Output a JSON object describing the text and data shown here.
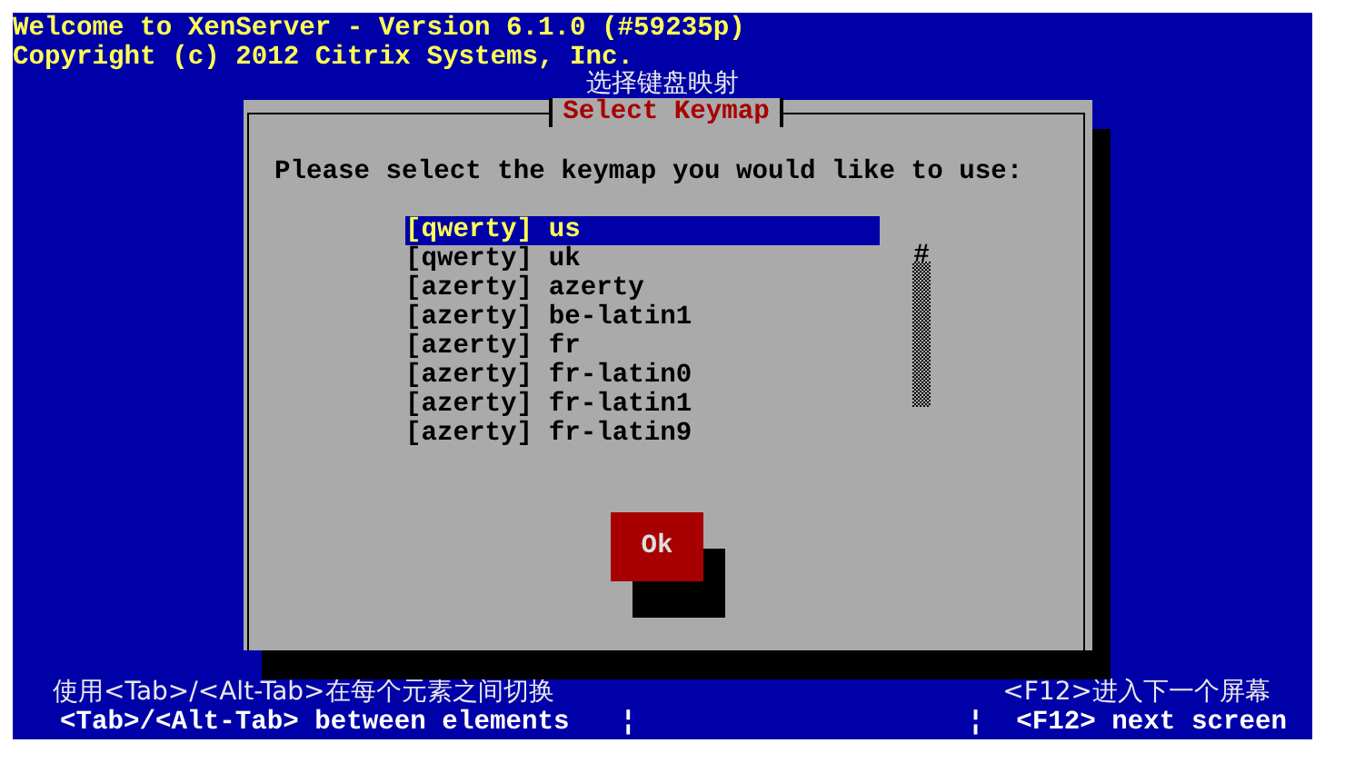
{
  "header": {
    "title": "Welcome to XenServer - Version 6.1.0 (#59235p)",
    "copyright": "Copyright (c) 2012 Citrix Systems, Inc."
  },
  "annotations": {
    "dialog": "选择键盘映射",
    "tab_hint": "使用<Tab>/<Alt-Tab>在每个元素之间切换",
    "next_hint": "<F12>进入下一个屏幕"
  },
  "dialog": {
    "title": "Select Keymap",
    "prompt": "Please select the keymap you would like to use:",
    "scroll_thumb": "#",
    "keymaps": [
      {
        "label": "[qwerty] us",
        "selected": true
      },
      {
        "label": "[qwerty] uk",
        "selected": false
      },
      {
        "label": "[azerty] azerty",
        "selected": false
      },
      {
        "label": "[azerty] be-latin1",
        "selected": false
      },
      {
        "label": "[azerty] fr",
        "selected": false
      },
      {
        "label": "[azerty] fr-latin0",
        "selected": false
      },
      {
        "label": "[azerty] fr-latin1",
        "selected": false
      },
      {
        "label": "[azerty] fr-latin9",
        "selected": false
      }
    ],
    "buttons": [
      "Ok"
    ]
  },
  "status_bar": [
    "<Tab>/<Alt-Tab> between elements",
    "¦",
    "¦",
    "<F12> next screen"
  ]
}
